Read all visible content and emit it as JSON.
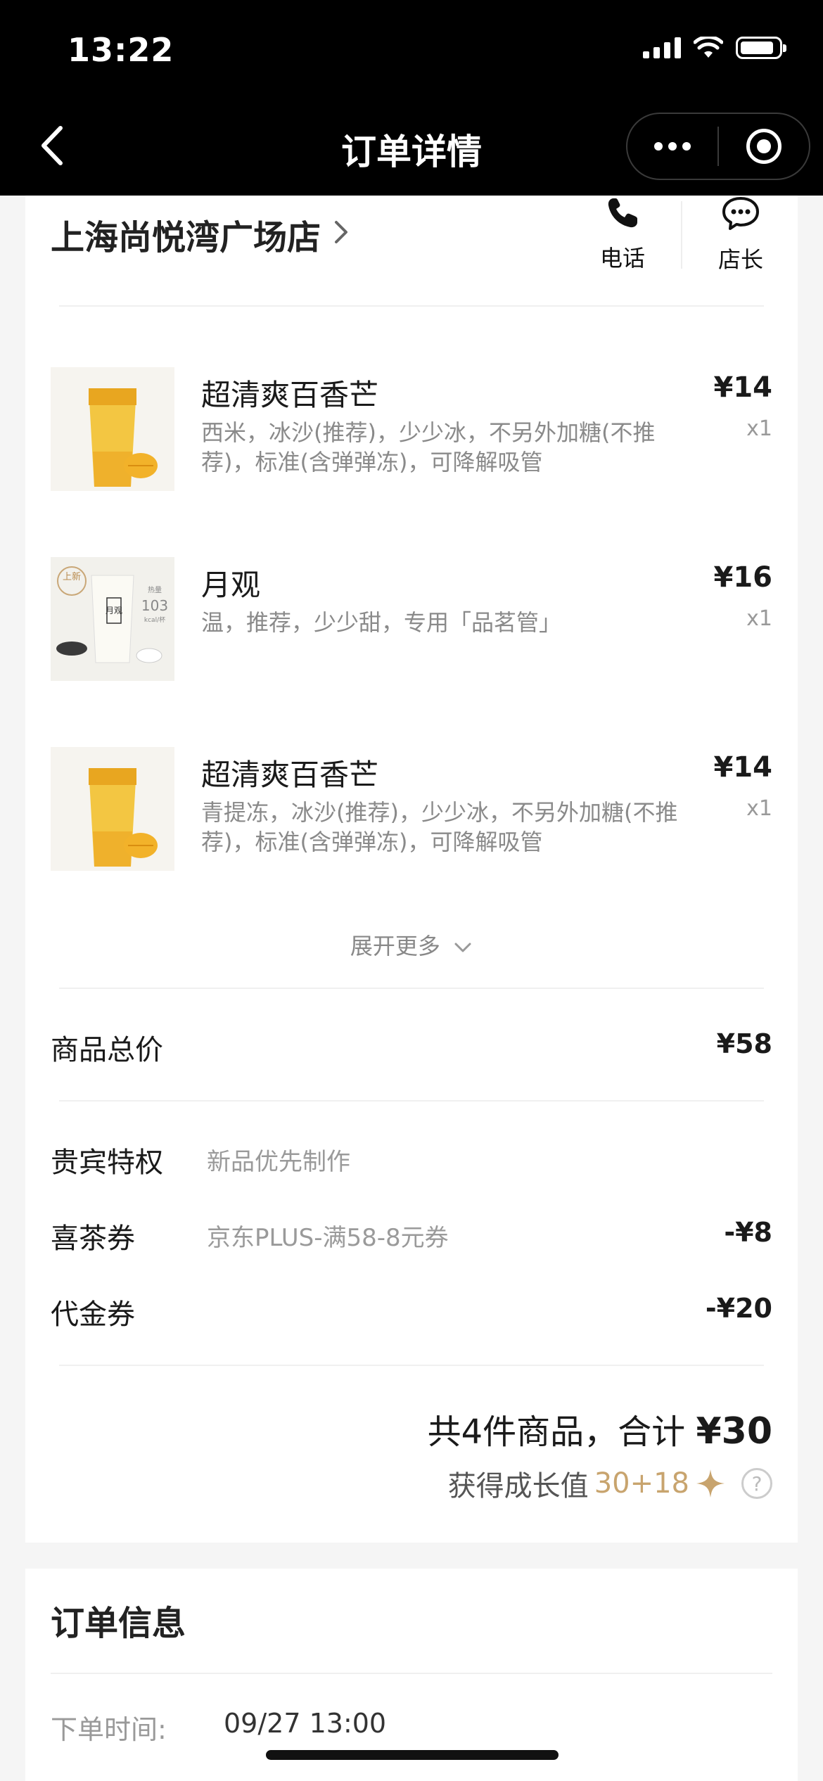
{
  "status_bar": {
    "time": "13:22"
  },
  "nav": {
    "title": "订单详情"
  },
  "store": {
    "name": "上海尚悦湾广场店",
    "phone_label": "电话",
    "manager_label": "店长"
  },
  "items": [
    {
      "name": "超清爽百香芒",
      "options": "西米，冰沙(推荐)，少少冰，不另外加糖(不推荐)，标准(含弹弹冻)，可降解吸管",
      "price": "¥14",
      "qty": "x1"
    },
    {
      "name": "月观",
      "options": "温，推荐，少少甜，专用「品茗管」",
      "price": "¥16",
      "qty": "x1"
    },
    {
      "name": "超清爽百香芒",
      "options": "青提冻，冰沙(推荐)，少少冰，不另外加糖(不推荐)，标准(含弹弹冻)，可降解吸管",
      "price": "¥14",
      "qty": "x1"
    }
  ],
  "thumb2": {
    "tag": "上新",
    "name": "月观",
    "kcal_label": "热量",
    "kcal": "103",
    "kcal_unit": "kcal/杯"
  },
  "expand_label": "展开更多",
  "summary": {
    "subtotal_label": "商品总价",
    "subtotal": "¥58",
    "vip_label": "贵宾特权",
    "vip_desc": "新品优先制作",
    "coupon_label": "喜茶券",
    "coupon_desc": "京东PLUS-满58-8元券",
    "coupon_amount": "-¥8",
    "voucher_label": "代金券",
    "voucher_amount": "-¥20",
    "total_prefix": "共4件商品，合计",
    "total_amount": "¥30",
    "growth_label": "获得成长值",
    "growth_value": "30+18"
  },
  "order_info": {
    "title": "订单信息",
    "time_label": "下单时间:",
    "time_value": "09/27 13:00"
  },
  "colors": {
    "accent_gold": "#c8a46e",
    "topbar": "#000000"
  }
}
